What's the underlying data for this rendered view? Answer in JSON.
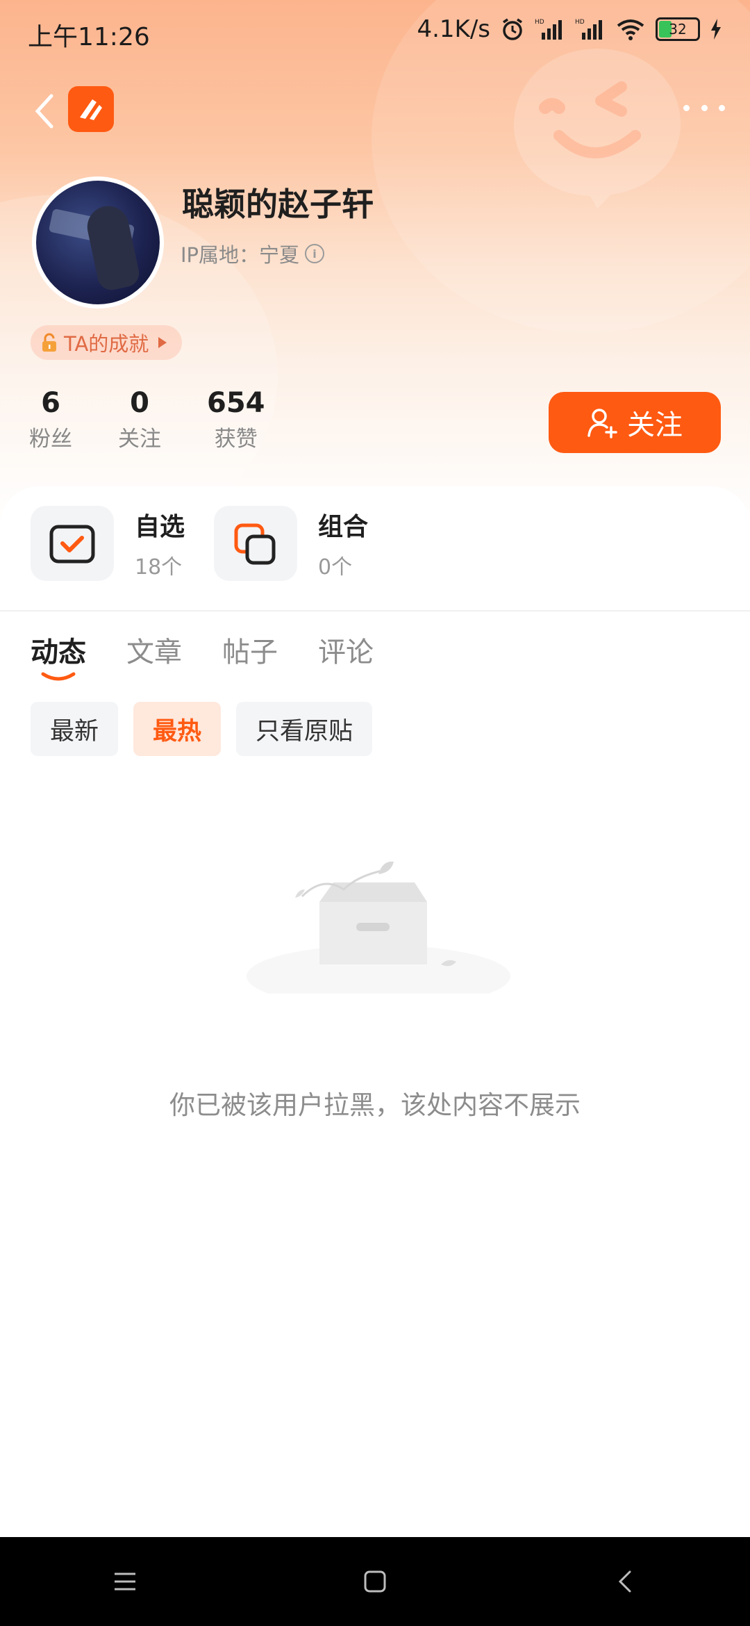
{
  "status_bar": {
    "time": "上午11:26",
    "net_speed": "4.1K/s",
    "battery": "32"
  },
  "profile": {
    "username": "聪颖的赵子轩",
    "ip_location": "IP属地：宁夏",
    "achievement_label": "TA的成就",
    "follow_button": "关注"
  },
  "stats": [
    {
      "value": "6",
      "label": "粉丝"
    },
    {
      "value": "0",
      "label": "关注"
    },
    {
      "value": "654",
      "label": "获赞"
    }
  ],
  "quick_entries": [
    {
      "title": "自选",
      "count": "18个"
    },
    {
      "title": "组合",
      "count": "0个"
    }
  ],
  "tabs": [
    "动态",
    "文章",
    "帖子",
    "评论"
  ],
  "filters": [
    "最新",
    "最热",
    "只看原贴"
  ],
  "empty_message": "你已被该用户拉黑，该处内容不展示",
  "colors": {
    "accent": "#ff5a12"
  }
}
